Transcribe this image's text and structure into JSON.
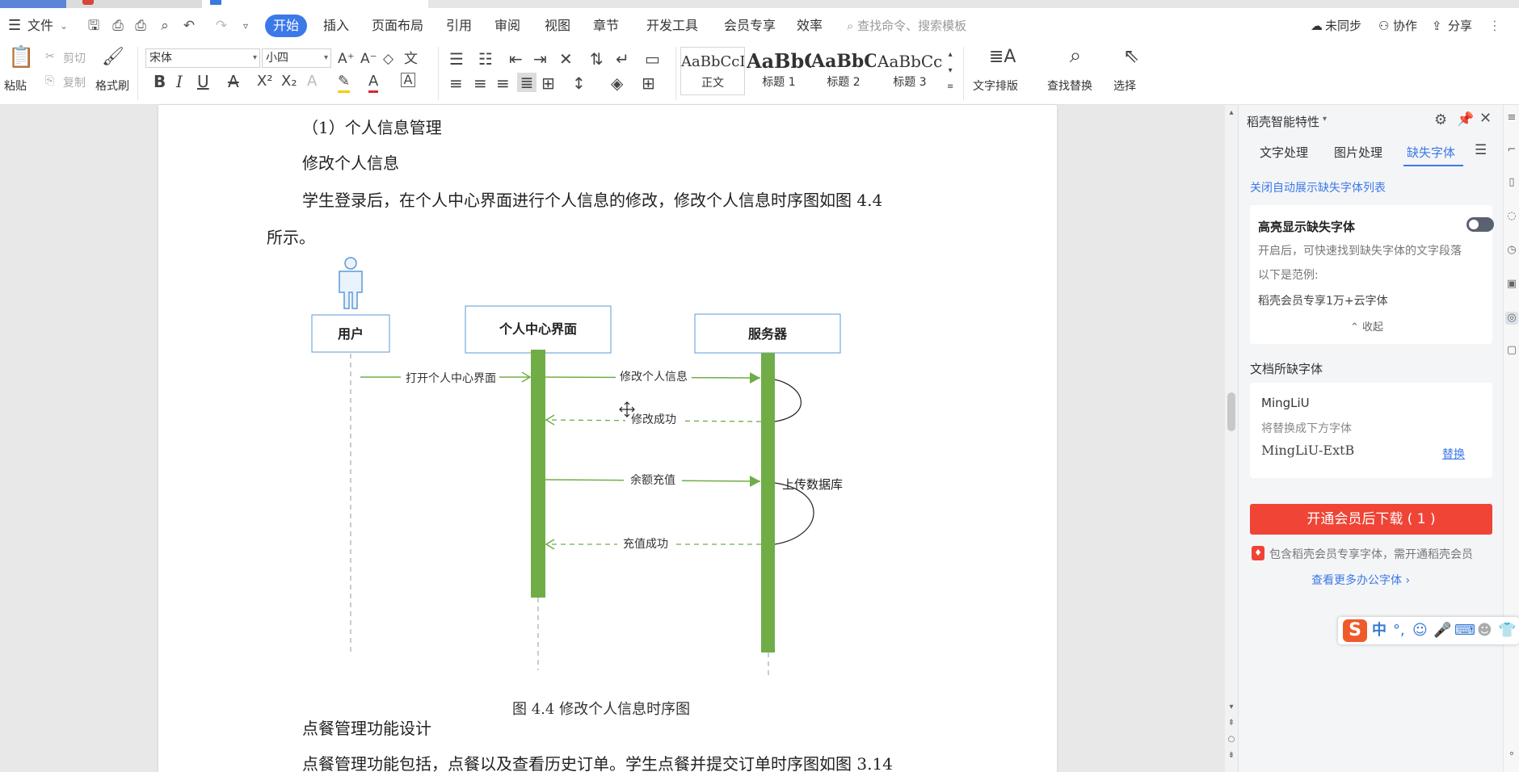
{
  "menu": {
    "file": "文件",
    "tabs": [
      "开始",
      "插入",
      "页面布局",
      "引用",
      "审阅",
      "视图",
      "章节",
      "开发工具",
      "会员专享",
      "效率"
    ],
    "search_placeholder": "查找命令、搜索模板",
    "unsynced": "未同步",
    "collab": "协作",
    "share": "分享"
  },
  "ribbon": {
    "paste": "粘贴",
    "cut": "剪切",
    "copy": "复制",
    "format_painter": "格式刷",
    "font_name": "宋体",
    "font_size": "小四",
    "styles": [
      {
        "sample": "AaBbCcI",
        "name": "正文"
      },
      {
        "sample": "AaBbC",
        "name": "标题 1"
      },
      {
        "sample": "AaBbC",
        "name": "标题 2"
      },
      {
        "sample": "AaBbCc",
        "name": "标题 3"
      }
    ],
    "text_layout": "文字排版",
    "find_replace": "查找替换",
    "select": "选择"
  },
  "document": {
    "p1": "（1）个人信息管理",
    "p2": "修改个人信息",
    "p3": "学生登录后，在个人中心界面进行个人信息的修改，修改个人信息时序图如图 4.4",
    "p4": "所示。",
    "diagram": {
      "lifelines": [
        "用户",
        "个人中心界面",
        "服务器"
      ],
      "messages": [
        "打开个人中心界面",
        "修改个人信息",
        "修改成功",
        "余额充值",
        "充值成功",
        "上传数据库"
      ]
    },
    "caption": "图 4.4 修改个人信息时序图",
    "p5": "点餐管理功能设计",
    "p6": "点餐管理功能包括，点餐以及查看历史订单。学生点餐并提交订单时序图如图 3.14"
  },
  "panel": {
    "title": "稻壳智能特性",
    "tabs": [
      "文字处理",
      "图片处理",
      "缺失字体"
    ],
    "active_tab": "缺失字体",
    "close_auto": "关闭自动展示缺失字体列表",
    "highlight_title": "高亮显示缺失字体",
    "highlight_desc": "开启后，可快速找到缺失字体的文字段落",
    "example_label": "以下是范例:",
    "example_value": "稻壳会员专享1万+云字体",
    "collapse": "收起",
    "missing_heading": "文档所缺字体",
    "missing_font": "MingLiU",
    "replace_with_label": "将替换成下方字体",
    "replacement_font": "MingLiU-ExtB",
    "replace": "替换",
    "download_btn": "开通会员后下载 ( 1 )",
    "note": "包含稻壳会员专享字体，需开通稻壳会员",
    "more": "查看更多办公字体"
  },
  "ime": {
    "mode": "中"
  },
  "colors": {
    "accent": "#3b79e8",
    "lifeline_bar": "#70ad47",
    "danger": "#ef4436",
    "link": "#3b79e8"
  }
}
